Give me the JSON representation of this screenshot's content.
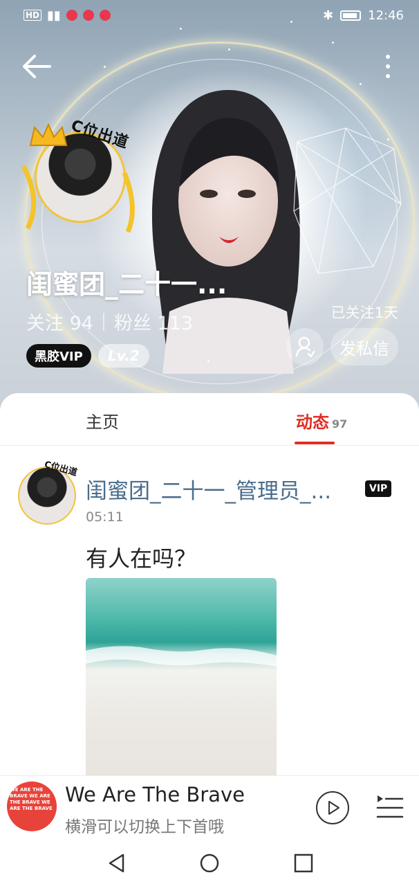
{
  "status_bar": {
    "network": "HD",
    "time": "12:46"
  },
  "profile": {
    "avatar_deco_text": "C位出道",
    "username": "闺蜜团_二十一...",
    "following_label": "关注",
    "following_count": "94",
    "fans_label": "粉丝",
    "fans_count": "113",
    "vip_badge": "黑胶VIP",
    "level_badge": "Lv.2",
    "followed_days": "已关注1天",
    "message_button": "发私信"
  },
  "tabs": {
    "home": "主页",
    "feed": "动态",
    "feed_count": "97"
  },
  "post": {
    "avatar_deco_text": "C位出道",
    "author": "闺蜜团_二十一_管理员_...",
    "vip_badge": "VIP",
    "time": "05:11",
    "text": "有人在吗？"
  },
  "player": {
    "cover_text": "WE ARE THE BRAVE WE ARE THE BRAVE WE ARE THE BRAVE",
    "title": "We Are The Brave",
    "subtitle": "横滑可以切换上下首哦"
  },
  "colors": {
    "accent_red": "#e02e24",
    "author_blue": "#4a6d8c",
    "vip_black": "#111111"
  }
}
